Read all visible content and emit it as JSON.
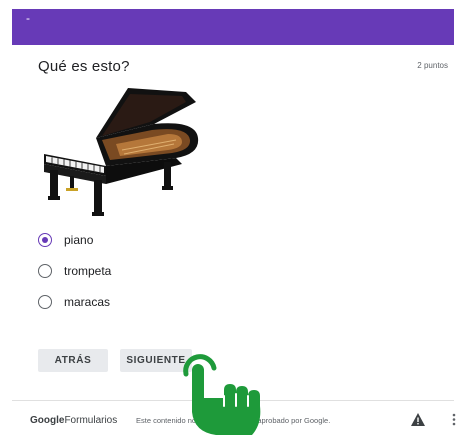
{
  "header": {
    "dot": "-"
  },
  "question": {
    "title": "Qué es esto?",
    "points": "2 puntos",
    "image_alt": "grand-piano"
  },
  "options": [
    {
      "label": "piano",
      "checked": true
    },
    {
      "label": "trompeta",
      "checked": false
    },
    {
      "label": "maracas",
      "checked": false
    }
  ],
  "buttons": {
    "back": "ATRÁS",
    "next": "SIGUIENTE"
  },
  "footer": {
    "brand_google": "Google",
    "brand_forms": "Formularios",
    "disclaimer": "Este contenido no ha sido creado ni aprobado por Google.",
    "icons": [
      "warning-icon",
      "more-vert-icon"
    ]
  },
  "colors": {
    "accent": "#673ab7",
    "button_bg": "#e8eaed",
    "cursor_green": "#1e9a3a"
  }
}
